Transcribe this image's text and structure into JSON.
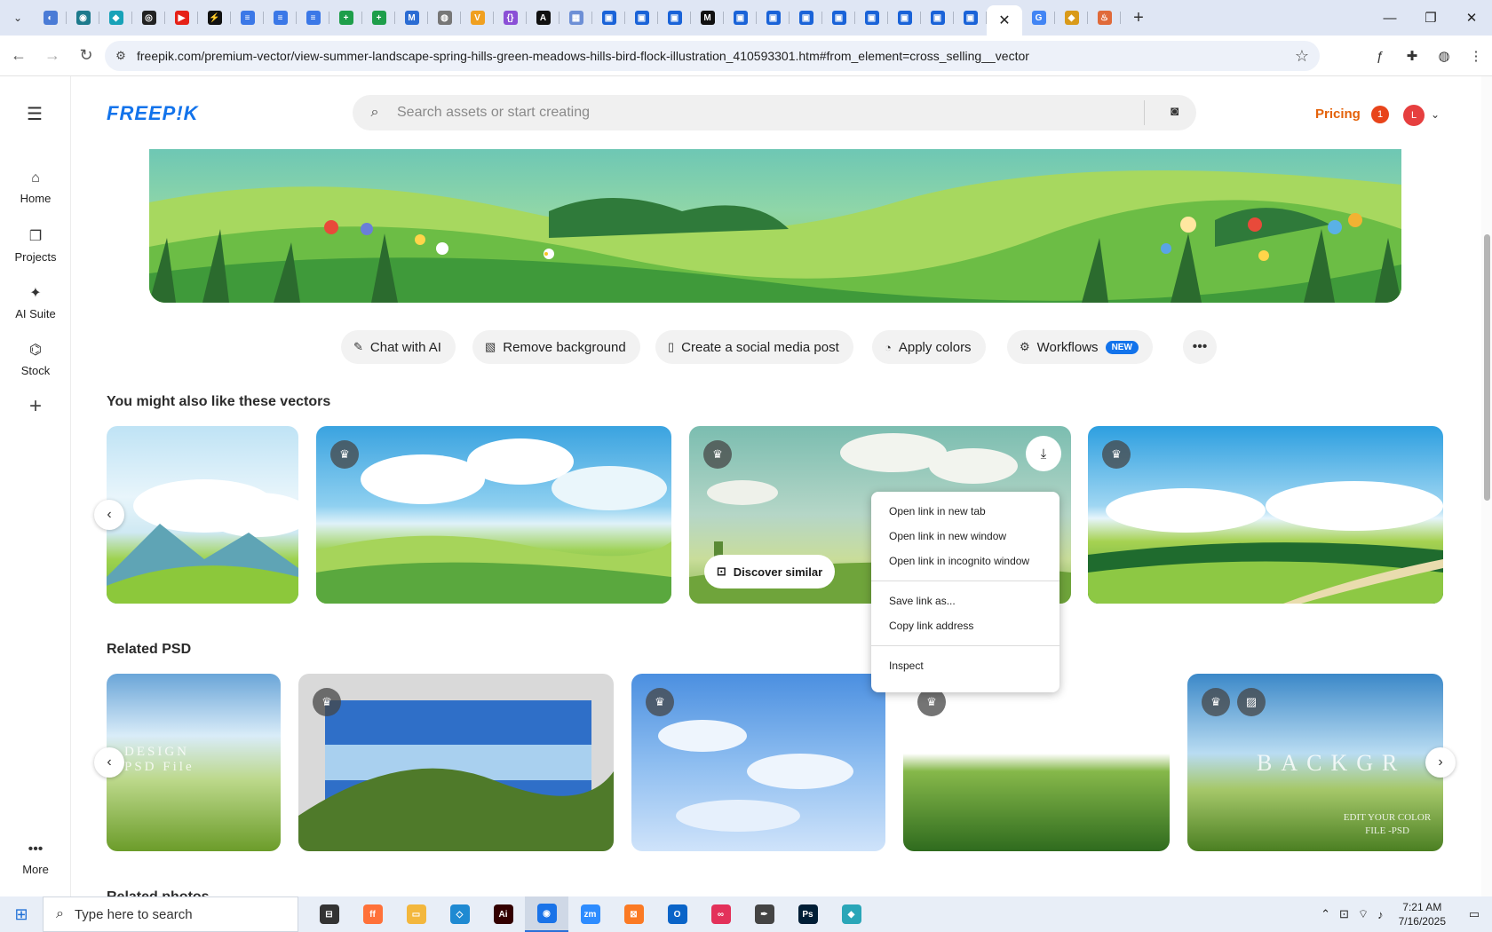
{
  "browser": {
    "active_tab_close": "✕",
    "new_tab": "+",
    "url": "freepik.com/premium-vector/view-summer-landscape-spring-hills-green-meadows-hills-bird-flock-illustration_410593301.htm#from_element=cross_selling__vector",
    "tabs": [
      {
        "name": "tab-1",
        "color": "#4a7bd6",
        "glyph": "◐"
      },
      {
        "name": "tab-2",
        "color": "#1d7a8c",
        "glyph": "◉"
      },
      {
        "name": "tab-3",
        "color": "#17a2b8",
        "glyph": "◆"
      },
      {
        "name": "tab-4",
        "color": "#222222",
        "glyph": "◎"
      },
      {
        "name": "tab-5",
        "color": "#e62117",
        "glyph": "▶"
      },
      {
        "name": "tab-6",
        "color": "#111111",
        "glyph": "⚡"
      },
      {
        "name": "tab-7",
        "color": "#3b78e7",
        "glyph": "≡"
      },
      {
        "name": "tab-8",
        "color": "#3b78e7",
        "glyph": "≡"
      },
      {
        "name": "tab-9",
        "color": "#3b78e7",
        "glyph": "≡"
      },
      {
        "name": "tab-10",
        "color": "#1e9e4a",
        "glyph": "+"
      },
      {
        "name": "tab-11",
        "color": "#1e9e4a",
        "glyph": "+"
      },
      {
        "name": "tab-12",
        "color": "#2b6cd3",
        "glyph": "M"
      },
      {
        "name": "tab-13",
        "color": "#777777",
        "glyph": "◍"
      },
      {
        "name": "tab-14",
        "color": "#f0a020",
        "glyph": "V"
      },
      {
        "name": "tab-15",
        "color": "#8a4fd6",
        "glyph": "{}"
      },
      {
        "name": "tab-16",
        "color": "#111111",
        "glyph": "A"
      },
      {
        "name": "tab-17",
        "color": "#6d8fd6",
        "glyph": "▦"
      },
      {
        "name": "tab-18",
        "color": "#1a63d8",
        "glyph": "▣"
      },
      {
        "name": "tab-19",
        "color": "#1a63d8",
        "glyph": "▣"
      },
      {
        "name": "tab-20",
        "color": "#1a63d8",
        "glyph": "▣"
      },
      {
        "name": "tab-21",
        "color": "#111111",
        "glyph": "M"
      },
      {
        "name": "tab-22",
        "color": "#1a63d8",
        "glyph": "▣"
      },
      {
        "name": "tab-23",
        "color": "#1a63d8",
        "glyph": "▣"
      },
      {
        "name": "tab-24",
        "color": "#1a63d8",
        "glyph": "▣"
      },
      {
        "name": "tab-25",
        "color": "#1a63d8",
        "glyph": "▣"
      },
      {
        "name": "tab-26",
        "color": "#1a63d8",
        "glyph": "▣"
      },
      {
        "name": "tab-27",
        "color": "#1a63d8",
        "glyph": "▣"
      },
      {
        "name": "tab-28",
        "color": "#1a63d8",
        "glyph": "▣"
      },
      {
        "name": "tab-29",
        "color": "#1a63d8",
        "glyph": "▣"
      }
    ],
    "after_tabs": [
      {
        "name": "tab-google",
        "color": "#4285f4",
        "glyph": "G"
      },
      {
        "name": "tab-31",
        "color": "#d99a1a",
        "glyph": "◆"
      },
      {
        "name": "tab-32",
        "color": "#e06a3a",
        "glyph": "♨"
      }
    ]
  },
  "rail": {
    "items": [
      {
        "label": "Home",
        "icon": "⌂"
      },
      {
        "label": "Projects",
        "icon": "❐"
      },
      {
        "label": "AI Suite",
        "icon": "✦"
      },
      {
        "label": "Stock",
        "icon": "⌬"
      }
    ],
    "more_label": "More"
  },
  "header": {
    "logo": "FREEP!K",
    "search_placeholder": "Search assets or start creating",
    "pricing": "Pricing",
    "notification_count": "1",
    "avatar_initial": "L"
  },
  "tools": [
    {
      "label": "Chat with AI",
      "icon": "✎"
    },
    {
      "label": "Remove background",
      "icon": "▧"
    },
    {
      "label": "Create a social media post",
      "icon": "▯"
    },
    {
      "label": "Apply colors",
      "icon": "◔"
    },
    {
      "label": "Workflows",
      "icon": "⚙",
      "badge": "NEW"
    }
  ],
  "sections": {
    "vectors_title": "You might also like these vectors",
    "psd_title": "Related PSD",
    "photos_title": "Related photos"
  },
  "card_text": {
    "discover_similar": "Discover similar",
    "psd1_overlay": "DESIGN\nPSD File",
    "psd5_overlay_big": "BACKGR",
    "psd5_overlay_small": "EDIT YOUR COLOR\nFILE -PSD"
  },
  "context_menu": {
    "open_new_tab": "Open link in new tab",
    "open_new_window": "Open link in new window",
    "open_incognito": "Open link in incognito window",
    "save_link": "Save link as...",
    "copy_link": "Copy link address",
    "inspect": "Inspect"
  },
  "taskbar": {
    "search_placeholder": "Type here to search",
    "time": "7:21 AM",
    "date": "7/16/2025",
    "apps": [
      {
        "name": "task-view",
        "color": "#333333",
        "glyph": "⊟"
      },
      {
        "name": "firefox",
        "color": "#ff7139",
        "glyph": "ff"
      },
      {
        "name": "file-explorer",
        "color": "#f3b73d",
        "glyph": "▭"
      },
      {
        "name": "vscode",
        "color": "#1f8ad2",
        "glyph": "◇"
      },
      {
        "name": "illustrator",
        "color": "#330000",
        "glyph": "Ai"
      },
      {
        "name": "chrome",
        "color": "#1a73e8",
        "glyph": "◉"
      },
      {
        "name": "zoom",
        "color": "#2d8cff",
        "glyph": "zm"
      },
      {
        "name": "xampp",
        "color": "#fb7a24",
        "glyph": "⊠"
      },
      {
        "name": "outlook",
        "color": "#0a64c8",
        "glyph": "O"
      },
      {
        "name": "creative-cloud",
        "color": "#e3315a",
        "glyph": "∞"
      },
      {
        "name": "pen-tool",
        "color": "#444444",
        "glyph": "✒"
      },
      {
        "name": "photoshop",
        "color": "#001e36",
        "glyph": "Ps"
      },
      {
        "name": "app-diamond",
        "color": "#2aa6b8",
        "glyph": "◆"
      }
    ]
  },
  "colors": {
    "brand": "#1273eb",
    "pricing": "#e4620a",
    "badge": "#1273eb"
  }
}
